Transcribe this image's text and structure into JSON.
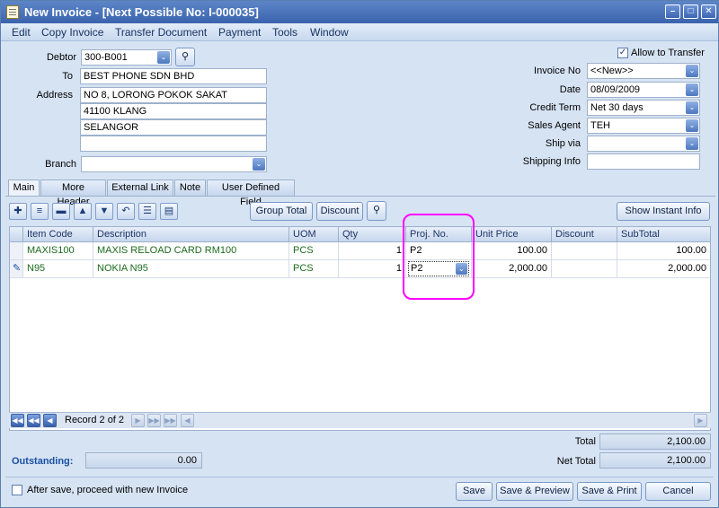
{
  "window": {
    "title": "New Invoice - [Next Possible No: I-000035]"
  },
  "menu": [
    "Edit",
    "Copy Invoice",
    "Transfer Document",
    "Payment",
    "Tools",
    "Window"
  ],
  "header": {
    "debtor_label": "Debtor",
    "debtor_value": "300-B001",
    "to_label": "To",
    "to_value": "BEST PHONE SDN BHD",
    "address_label": "Address",
    "address_lines": [
      "NO 8, LORONG POKOK SAKAT",
      "41100 KLANG",
      "SELANGOR",
      ""
    ],
    "branch_label": "Branch",
    "branch_value": "",
    "allow_transfer_label": "Allow to Transfer",
    "allow_transfer_checked": true,
    "invoice_no_label": "Invoice No",
    "invoice_no_value": "<<New>>",
    "date_label": "Date",
    "date_value": "08/09/2009",
    "credit_term_label": "Credit Term",
    "credit_term_value": "Net 30 days",
    "sales_agent_label": "Sales Agent",
    "sales_agent_value": "TEH",
    "ship_via_label": "Ship via",
    "ship_via_value": "",
    "shipping_info_label": "Shipping Info",
    "shipping_info_value": ""
  },
  "tabs": [
    "Main",
    "More Header",
    "External Link",
    "Note",
    "User Defined Field"
  ],
  "toolbar": {
    "group_total": "Group Total",
    "discount": "Discount",
    "show_instant_info": "Show Instant Info"
  },
  "grid": {
    "columns": [
      "Item Code",
      "Description",
      "UOM",
      "Qty",
      "Proj. No.",
      "Unit Price",
      "Discount",
      "SubTotal"
    ],
    "rows": [
      {
        "item_code": "MAXIS100",
        "description": "MAXIS RELOAD CARD RM100",
        "uom": "PCS",
        "qty": "1",
        "proj_no": "P2",
        "unit_price": "100.00",
        "discount": "",
        "subtotal": "100.00"
      },
      {
        "item_code": "N95",
        "description": "NOKIA N95",
        "uom": "PCS",
        "qty": "1",
        "proj_no": "P2",
        "unit_price": "2,000.00",
        "discount": "",
        "subtotal": "2,000.00"
      }
    ],
    "record_text": "Record 2 of 2"
  },
  "totals": {
    "total_label": "Total",
    "total_value": "2,100.00",
    "net_total_label": "Net Total",
    "net_total_value": "2,100.00",
    "outstanding_label": "Outstanding:",
    "outstanding_value": "0.00"
  },
  "footer": {
    "proceed_label": "After save, proceed with new Invoice",
    "proceed_checked": false,
    "save": "Save",
    "save_preview": "Save & Preview",
    "save_print": "Save & Print",
    "cancel": "Cancel"
  },
  "colors": {
    "highlight": "#ff00ff",
    "titlebar": "#3a63ad",
    "accent": "#1a4fa3",
    "item_text": "#1d6b1d"
  }
}
